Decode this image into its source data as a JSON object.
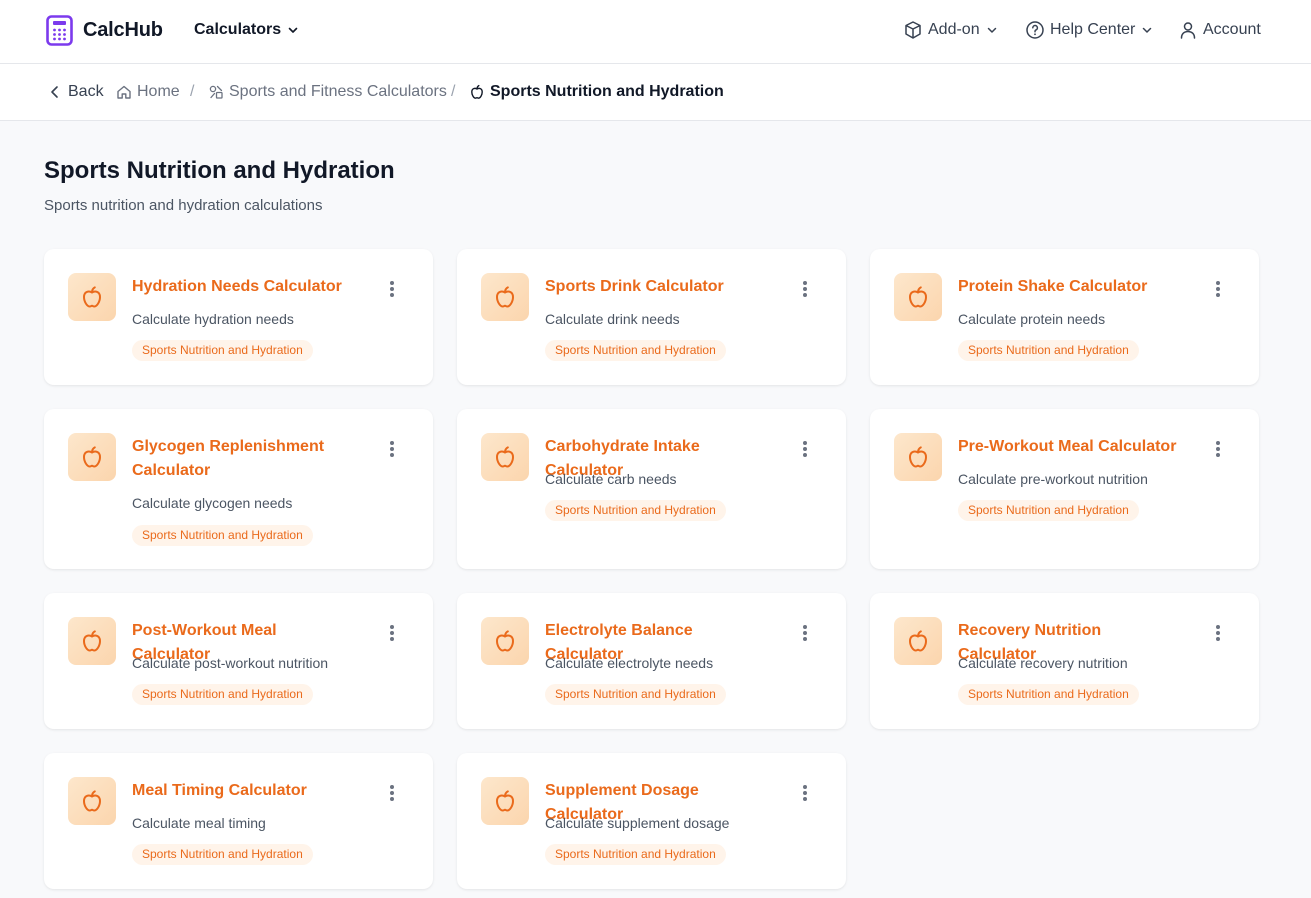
{
  "header": {
    "brand": "CalcHub",
    "calculators_label": "Calculators",
    "addon_label": "Add-on",
    "help_label": "Help Center",
    "account_label": "Account"
  },
  "breadcrumb": {
    "back": "Back",
    "home": "Home",
    "parent": "Sports and Fitness Calculators",
    "current": "Sports Nutrition and Hydration"
  },
  "page": {
    "title": "Sports Nutrition and Hydration",
    "subtitle": "Sports nutrition and hydration calculations"
  },
  "colors": {
    "accent": "#ea6a1b",
    "brand_purple": "#7c3aed",
    "tag_bg": "#fff4ea"
  },
  "cards": [
    {
      "title": "Hydration Needs Calculator",
      "desc": "Calculate hydration needs",
      "tag": "Sports Nutrition and Hydration",
      "icon": "apple-icon"
    },
    {
      "title": "Sports Drink Calculator",
      "desc": "Calculate drink needs",
      "tag": "Sports Nutrition and Hydration",
      "icon": "apple-icon"
    },
    {
      "title": "Protein Shake Calculator",
      "desc": "Calculate protein needs",
      "tag": "Sports Nutrition and Hydration",
      "icon": "apple-icon"
    },
    {
      "title": "Glycogen Replenishment Calculator",
      "desc": "Calculate glycogen needs",
      "tag": "Sports Nutrition and Hydration",
      "icon": "apple-icon"
    },
    {
      "title": "Carbohydrate Intake Calculator",
      "desc": "Calculate carb needs",
      "tag": "Sports Nutrition and Hydration",
      "icon": "apple-icon"
    },
    {
      "title": "Pre-Workout Meal Calculator",
      "desc": "Calculate pre-workout nutrition",
      "tag": "Sports Nutrition and Hydration",
      "icon": "apple-icon"
    },
    {
      "title": "Post-Workout Meal Calculator",
      "desc": "Calculate post-workout nutrition",
      "tag": "Sports Nutrition and Hydration",
      "icon": "apple-icon"
    },
    {
      "title": "Electrolyte Balance Calculator",
      "desc": "Calculate electrolyte needs",
      "tag": "Sports Nutrition and Hydration",
      "icon": "apple-icon"
    },
    {
      "title": "Recovery Nutrition Calculator",
      "desc": "Calculate recovery nutrition",
      "tag": "Sports Nutrition and Hydration",
      "icon": "apple-icon"
    },
    {
      "title": "Meal Timing Calculator",
      "desc": "Calculate meal timing",
      "tag": "Sports Nutrition and Hydration",
      "icon": "apple-icon"
    },
    {
      "title": "Supplement Dosage Calculator",
      "desc": "Calculate supplement dosage",
      "tag": "Sports Nutrition and Hydration",
      "icon": "apple-icon"
    }
  ]
}
